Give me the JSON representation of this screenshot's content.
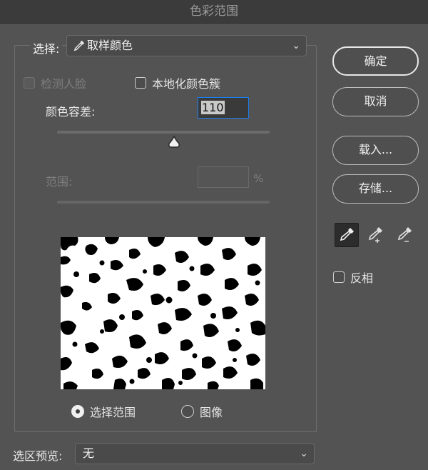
{
  "window": {
    "title": "色彩范围"
  },
  "select": {
    "label": "选择:",
    "value": "取样颜色",
    "icon": "eyedropper-icon"
  },
  "detect_faces": {
    "label": "检测人脸",
    "checked": false,
    "enabled": false
  },
  "localized_clusters": {
    "label": "本地化颜色簇",
    "checked": false
  },
  "fuzziness": {
    "label": "颜色容差:",
    "value": "110",
    "slider_fraction": 0.55
  },
  "range": {
    "label": "范围:",
    "value": "",
    "unit": "%",
    "enabled": false
  },
  "view_options": [
    {
      "label": "选择范围",
      "selected": true
    },
    {
      "label": "图像",
      "selected": false
    }
  ],
  "buttons": {
    "ok": "确定",
    "cancel": "取消",
    "load": "载入...",
    "save": "存储..."
  },
  "tools": [
    {
      "name": "eyedropper-icon",
      "active": true
    },
    {
      "name": "eyedropper-plus-icon",
      "active": false
    },
    {
      "name": "eyedropper-minus-icon",
      "active": false
    }
  ],
  "invert": {
    "label": "反相",
    "checked": false
  },
  "selection_preview": {
    "label": "选区预览:",
    "value": "无"
  },
  "colors": {
    "background": "#535353",
    "accent": "#1a7ef0"
  }
}
